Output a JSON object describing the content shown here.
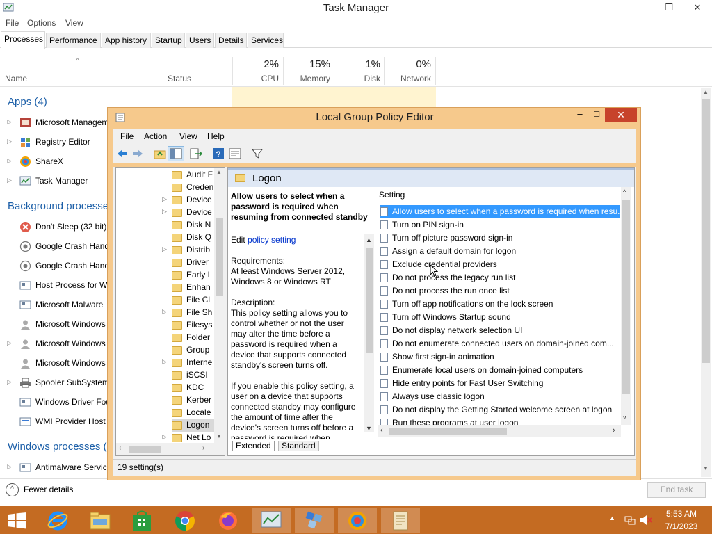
{
  "task_manager": {
    "title": "Task Manager",
    "menu": [
      "File",
      "Options",
      "View"
    ],
    "tabs": [
      "Processes",
      "Performance",
      "App history",
      "Startup",
      "Users",
      "Details",
      "Services"
    ],
    "columns": {
      "name": "Name",
      "status": "Status",
      "cpu": {
        "pct": "2%",
        "label": "CPU"
      },
      "memory": {
        "pct": "15%",
        "label": "Memory"
      },
      "disk": {
        "pct": "1%",
        "label": "Disk"
      },
      "network": {
        "pct": "0%",
        "label": "Network"
      }
    },
    "sections": {
      "apps": "Apps (4)",
      "background": "Background processes",
      "windows": "Windows processes ("
    },
    "apps": [
      "Microsoft Managem",
      "Registry Editor",
      "ShareX",
      "Task Manager"
    ],
    "background": [
      "Don't Sleep (32 bit)",
      "Google Crash Hand",
      "Google Crash Hand",
      "Host Process for Wi",
      "Microsoft Malware",
      "Microsoft Windows",
      "Microsoft Windows",
      "Microsoft Windows",
      "Spooler SubSystem",
      "Windows Driver Fou",
      "WMI Provider Host"
    ],
    "windows": [
      "Antimalware Servic"
    ],
    "fewer_details": "Fewer details",
    "end_task": "End task"
  },
  "gpe": {
    "title": "Local Group Policy Editor",
    "menu": [
      "File",
      "Action",
      "View",
      "Help"
    ],
    "tree": [
      "Audit F",
      "Creden",
      "Device",
      "Device",
      "Disk N",
      "Disk Q",
      "Distrib",
      "Driver",
      "Early L",
      "Enhan",
      "File Cl",
      "File Sh",
      "Filesys",
      "Folder",
      "Group",
      "Interne",
      "iSCSI",
      "KDC",
      "Kerber",
      "Locale",
      "Logon",
      "Net Lo"
    ],
    "folder_title": "Logon",
    "description": {
      "heading": "Allow users to select when a password is required when resuming from connected standby",
      "edit_prefix": "Edit",
      "edit_link": "policy setting",
      "req_label": "Requirements:",
      "req_text": "At least Windows Server 2012, Windows 8 or Windows RT",
      "desc_label": "Description:",
      "desc_text1": "This policy setting allows you to control whether or not the user may alter the time before a password is required when a device that supports connected standby's screen turns off.",
      "desc_text2": "If you enable this policy setting, a user on a device that supports connected standby may configure the amount of time after the device's screen turns off before a password is required when waking"
    },
    "setting_header": "Setting",
    "settings": [
      "Allow users to select when a password is required when resu...",
      "Turn on PIN sign-in",
      "Turn off picture password sign-in",
      "Assign a default domain for logon",
      "Exclude credential providers",
      "Do not process the legacy run list",
      "Do not process the run once list",
      "Turn off app notifications on the lock screen",
      "Turn off Windows Startup sound",
      "Do not display network selection UI",
      "Do not enumerate connected users on domain-joined com...",
      "Show first sign-in animation",
      "Enumerate local users on domain-joined computers",
      "Hide entry points for Fast User Switching",
      "Always use classic logon",
      "Do not display the Getting Started welcome screen at logon",
      "Run these programs at user logon"
    ],
    "view_tabs": [
      "Extended",
      "Standard"
    ],
    "status": "19 setting(s)"
  },
  "taskbar": {
    "time": "5:53 AM",
    "date": "7/1/2023"
  }
}
